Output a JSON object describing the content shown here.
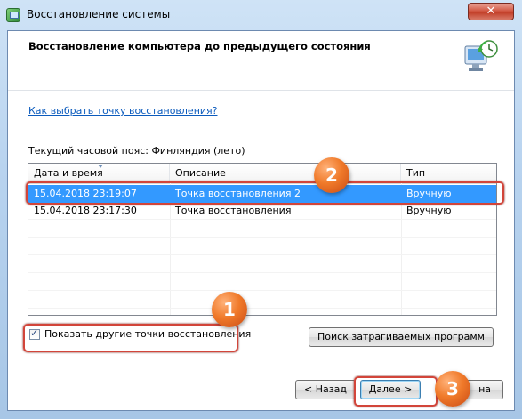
{
  "window": {
    "title": "Восстановление системы",
    "close_glyph": "✕"
  },
  "header": {
    "heading": "Восстановление компьютера до предыдущего состояния",
    "icon": "system-restore-icon"
  },
  "help_link": "Как выбрать точку восстановления?",
  "timezone_label": "Текущий часовой пояс: Финляндия (лето)",
  "table": {
    "columns": [
      "Дата и время",
      "Описание",
      "Тип"
    ],
    "rows": [
      {
        "date": "15.04.2018 23:19:07",
        "description": "Точка восстановления 2",
        "type": "Вручную",
        "selected": true
      },
      {
        "date": "15.04.2018 23:17:30",
        "description": "Точка восстановления",
        "type": "Вручную",
        "selected": false
      }
    ]
  },
  "show_more_checkbox": {
    "label": "Показать другие точки восстановления",
    "checked": true
  },
  "buttons": {
    "scan": "Поиск затрагиваемых программ",
    "back": "< Назад",
    "next": "Далее >",
    "cancel": "на"
  },
  "annotations": {
    "badge1": "1",
    "badge2": "2",
    "badge3": "3",
    "highlight_color": "#d2453a",
    "badge_color": "#f07a2a"
  }
}
